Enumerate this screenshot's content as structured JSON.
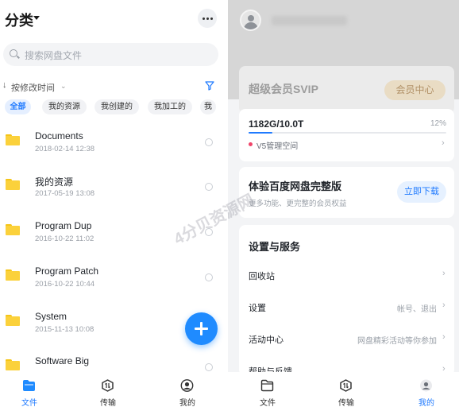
{
  "left": {
    "header": {
      "title": "分类"
    },
    "search": {
      "placeholder": "搜索网盘文件"
    },
    "sort": {
      "label": "按修改时间",
      "arrow": "↓"
    },
    "chips": [
      "全部",
      "我的资源",
      "我创建的",
      "我加工的",
      "我"
    ],
    "files": [
      {
        "name": "Documents",
        "date": "2018-02-14  12:38"
      },
      {
        "name": "我的资源",
        "date": "2017-05-19  13:08"
      },
      {
        "name": "Program Dup",
        "date": "2016-10-22  11:02"
      },
      {
        "name": "Program Patch",
        "date": "2016-10-22  10:44"
      },
      {
        "name": "System",
        "date": "2015-11-13  10:08"
      },
      {
        "name": "Software Big",
        "date": ""
      }
    ],
    "tabs": [
      {
        "label": "文件",
        "icon": "folder-icon"
      },
      {
        "label": "传输",
        "icon": "transfer-icon"
      },
      {
        "label": "我的",
        "icon": "user-icon"
      }
    ]
  },
  "right": {
    "vip": {
      "title": "超级会员SVIP",
      "center": "会员中心"
    },
    "storage": {
      "used": "1182G/10.0T",
      "percent": "12%",
      "progress": 0.12,
      "v5": "V5管理空间"
    },
    "trial": {
      "title": "体验百度网盘完整版",
      "subtitle": "更多功能、更完整的会员权益",
      "button": "立即下载"
    },
    "settings": {
      "title": "设置与服务",
      "items": [
        {
          "label": "回收站",
          "value": ""
        },
        {
          "label": "设置",
          "value": "帐号、退出"
        },
        {
          "label": "活动中心",
          "value": "网盘精彩活动等你参加"
        },
        {
          "label": "帮助与反馈",
          "value": ""
        }
      ]
    },
    "tabs": [
      {
        "label": "文件",
        "icon": "folder-icon"
      },
      {
        "label": "传输",
        "icon": "transfer-icon"
      },
      {
        "label": "我的",
        "icon": "user-icon"
      }
    ]
  },
  "watermark": "4分贝资源网",
  "colors": {
    "accent": "#1f7aff",
    "folder": "#fbd13b",
    "fab": "#1f8bff",
    "vip_gold": "#b08f65"
  }
}
